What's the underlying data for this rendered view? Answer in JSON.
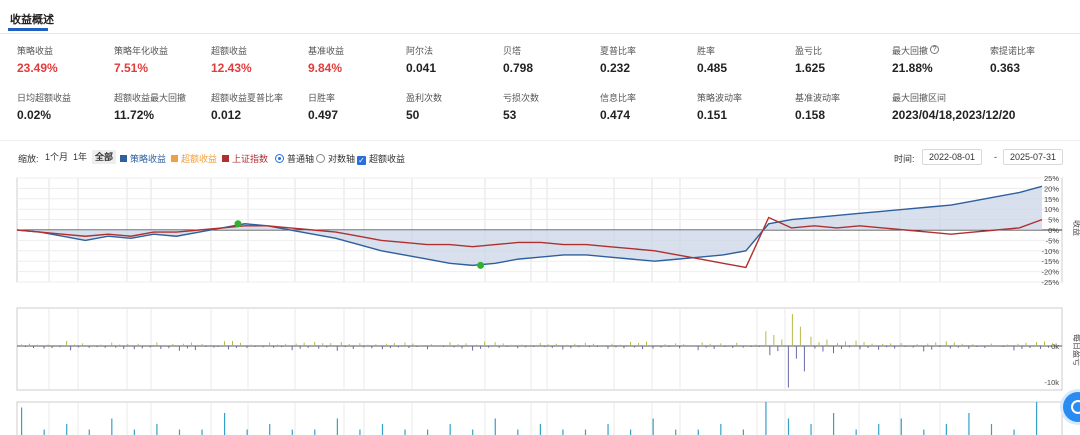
{
  "header": {
    "title": "收益概述"
  },
  "stats": [
    {
      "label": "策略收益",
      "value": "23.49%",
      "red": true
    },
    {
      "label": "策略年化收益",
      "value": "7.51%",
      "red": true
    },
    {
      "label": "超额收益",
      "value": "12.43%",
      "red": true
    },
    {
      "label": "基准收益",
      "value": "9.84%",
      "red": true
    },
    {
      "label": "阿尔法",
      "value": "0.041"
    },
    {
      "label": "贝塔",
      "value": "0.798"
    },
    {
      "label": "夏普比率",
      "value": "0.232"
    },
    {
      "label": "胜率",
      "value": "0.485"
    },
    {
      "label": "盈亏比",
      "value": "1.625"
    },
    {
      "label": "最大回撤",
      "value": "21.88%",
      "help_icon": "question-circle-icon"
    },
    {
      "label": "索提诺比率",
      "value": "0.363"
    },
    {
      "label": "日均超额收益",
      "value": "0.02%"
    },
    {
      "label": "超额收益最大回撤",
      "value": "11.72%"
    },
    {
      "label": "超额收益夏普比率",
      "value": "0.012"
    },
    {
      "label": "日胜率",
      "value": "0.497"
    },
    {
      "label": "盈利次数",
      "value": "50"
    },
    {
      "label": "亏损次数",
      "value": "53"
    },
    {
      "label": "信息比率",
      "value": "0.474"
    },
    {
      "label": "策略波动率",
      "value": "0.151"
    },
    {
      "label": "基准波动率",
      "value": "0.158"
    },
    {
      "label": "最大回撤区间",
      "value": "2023/04/18,2023/12/20"
    }
  ],
  "toolbar": {
    "zoom_label": "缩放:",
    "zoom_options": [
      "1个月",
      "1年",
      "全部"
    ],
    "zoom_active": "全部",
    "legend": [
      {
        "label": "策略收益",
        "color": "#2e5f9e"
      },
      {
        "label": "超额收益",
        "color": "#f0a040"
      },
      {
        "label": "上证指数",
        "color": "#b03030"
      }
    ],
    "axis_options": [
      "普通轴",
      "对数轴"
    ],
    "axis_selected": "普通轴",
    "excess_checkbox_label": "超额收益",
    "excess_checked": true,
    "time_label": "时间:",
    "start_date": "2022-08-01",
    "date_sep": "-",
    "end_date": "2025-07-31"
  },
  "chart_data": [
    {
      "type": "line",
      "x_range": [
        "2022-08-01",
        "2025-07-31"
      ],
      "ylabel": "收益",
      "yticks": [
        "25%",
        "20%",
        "15%",
        "10%",
        "5%",
        "0%",
        "-5%",
        "-10%",
        "-15%",
        "-20%",
        "-25%"
      ],
      "ylim": [
        -25,
        25
      ],
      "grid": true,
      "series": [
        {
          "name": "策略收益",
          "color": "#2e5f9e",
          "fill": "#c9d3e6",
          "values": [
            0,
            -1,
            -3,
            -5,
            -3,
            -4,
            -2,
            -3,
            -1,
            1,
            3,
            2,
            0,
            -2,
            -4,
            -7,
            -10,
            -12,
            -14,
            -16,
            -17,
            -16,
            -14,
            -13,
            -12,
            -12,
            -13,
            -14,
            -15,
            -14,
            -13,
            -12,
            -10,
            3,
            5,
            6,
            7,
            8,
            9,
            10,
            11,
            12,
            14,
            16,
            18,
            21
          ]
        },
        {
          "name": "上证指数",
          "color": "#b03030",
          "values": [
            0,
            -1,
            -2,
            -3,
            -2,
            -3,
            -1,
            -1,
            0,
            1,
            2,
            2,
            1,
            0,
            -1,
            -3,
            -5,
            -6,
            -7,
            -7,
            -8,
            -7,
            -6,
            -6,
            -7,
            -7,
            -8,
            -9,
            -10,
            -12,
            -14,
            -16,
            -18,
            6,
            1,
            2,
            1,
            2,
            1,
            0,
            -1,
            -2,
            -1,
            0,
            1,
            5
          ]
        }
      ],
      "markers": [
        {
          "label": "max_high",
          "x_index": 9,
          "y": 3,
          "color": "#2db32d"
        },
        {
          "label": "max_low",
          "x_index": 20,
          "y": -17,
          "color": "#2db32d"
        }
      ]
    },
    {
      "type": "bar",
      "ylabel": "每日盈亏",
      "yticks": [
        "0k",
        "-10k"
      ],
      "values": [
        0.3,
        -0.4,
        0.6,
        -0.2,
        0.5,
        -0.5,
        0.4,
        -0.6,
        0.3,
        0.7,
        -0.3,
        0.4,
        -0.5,
        0.6,
        -0.7,
        0.3,
        -0.4,
        0.5,
        -0.3,
        0.4,
        -0.6,
        0.5,
        -0.2,
        0.3,
        -0.5,
        0.4,
        -0.3,
        0.6,
        -0.4,
        0.3,
        -0.5,
        0.4,
        -0.3,
        1.8,
        -5.2,
        1.2,
        -0.8,
        0.6,
        -0.5,
        0.4,
        -0.6,
        0.5,
        -0.4,
        0.3,
        -0.5,
        0.6
      ],
      "pos_color": "#b8b84a",
      "neg_color": "#6a6aa8"
    },
    {
      "type": "bar",
      "values": [
        0.5,
        0.1,
        0.2,
        0.1,
        0.3,
        0.1,
        0.2,
        0.1,
        0.1,
        0.4,
        0.1,
        0.2,
        0.1,
        0.1,
        0.3,
        0.1,
        0.2,
        0.1,
        0.1,
        0.2,
        0.1,
        0.3,
        0.1,
        0.2,
        0.1,
        0.1,
        0.2,
        0.1,
        0.3,
        0.1,
        0.1,
        0.2,
        0.1,
        0.6,
        0.3,
        0.2,
        0.4,
        0.1,
        0.2,
        0.3,
        0.1,
        0.2,
        0.4,
        0.2,
        0.1,
        0.6
      ],
      "color": "#35a0c8"
    }
  ]
}
